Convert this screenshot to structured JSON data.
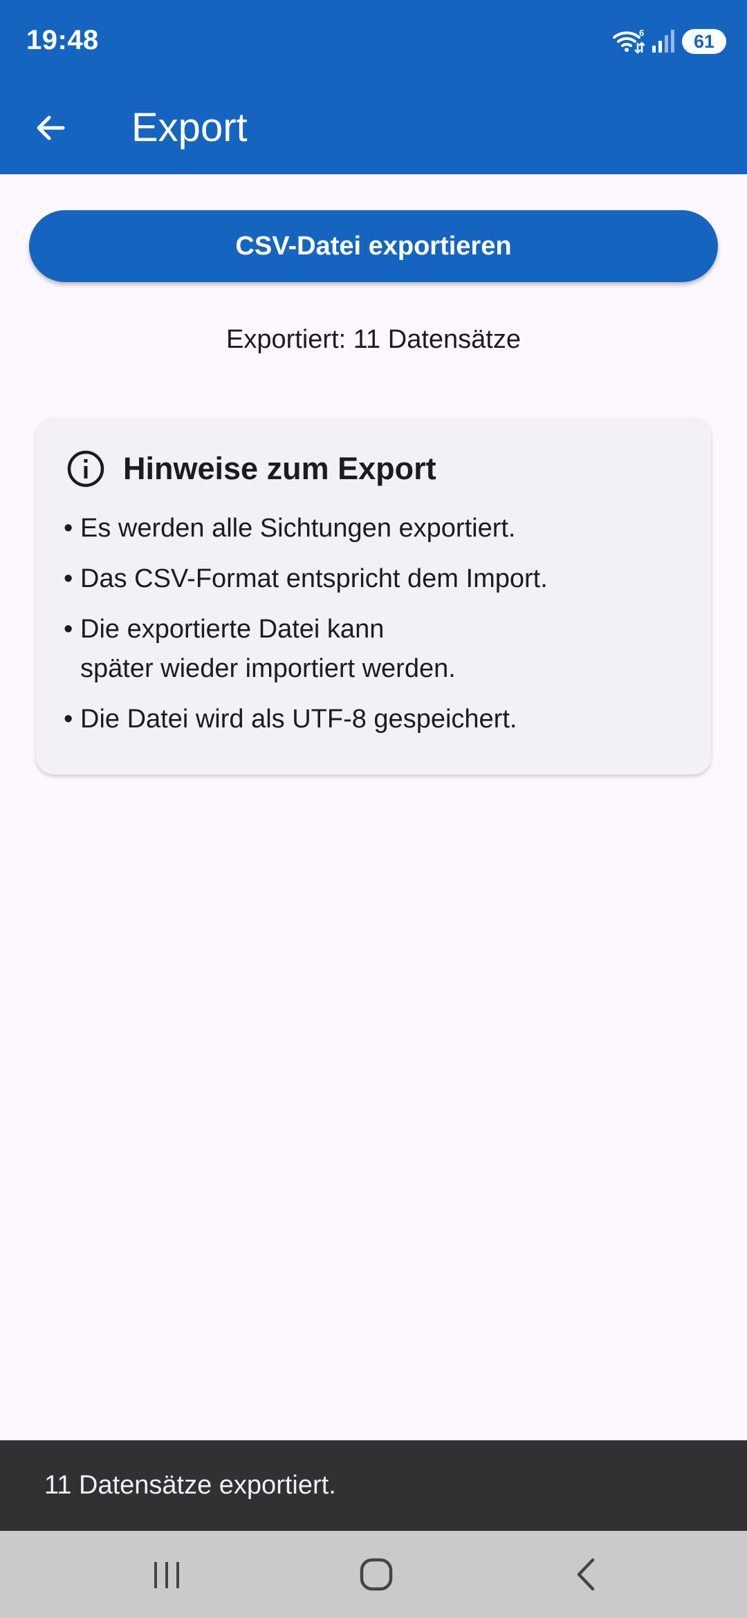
{
  "status_bar": {
    "time": "19:48",
    "wifi_badge": "6",
    "battery_level": "61",
    "icons": [
      "wifi-icon",
      "signal-icon",
      "battery-icon"
    ]
  },
  "app_bar": {
    "title": "Export",
    "back_icon": "arrow-back-icon",
    "color": "#1565c0"
  },
  "export_button": {
    "label": "CSV-Datei exportieren"
  },
  "export_status": "Exportiert: 11 Datensätze",
  "info_card": {
    "icon": "info-icon",
    "title": "Hinweise zum Export",
    "bullet": "•",
    "notes": [
      "Es werden alle Sichtungen exportiert.",
      "Das CSV-Format entspricht dem Import.",
      "Die exportierte Datei kann\nspäter wieder importiert werden.",
      "Die Datei wird als UTF-8 gespeichert."
    ]
  },
  "snackbar": {
    "message": "11 Datensätze exportiert."
  },
  "nav_bar": {
    "buttons": [
      "recent-apps-icon",
      "home-icon",
      "back-icon"
    ]
  }
}
